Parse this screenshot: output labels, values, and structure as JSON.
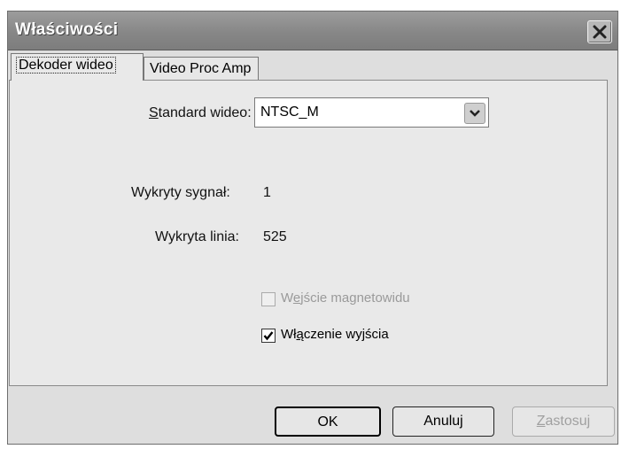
{
  "window": {
    "title": "Właściwości"
  },
  "tabs": [
    {
      "label": "Dekoder wideo",
      "active": true
    },
    {
      "label": "Video Proc Amp",
      "active": false
    }
  ],
  "standard": {
    "label_accel": "S",
    "label_rest": "tandard wideo:",
    "selected": "NTSC_M"
  },
  "signal": {
    "label": "Wykryty sygnał:",
    "value": "1"
  },
  "line": {
    "label": "Wykryta linia:",
    "value": "525"
  },
  "vcr_input": {
    "label_pre": "W",
    "label_accel": "e",
    "label_post": "jście magnetowidu",
    "checked": false,
    "enabled": false
  },
  "output_enable": {
    "label_pre": "Wł",
    "label_accel": "ą",
    "label_post": "czenie wyjścia",
    "checked": true,
    "enabled": true
  },
  "buttons": {
    "ok": "OK",
    "cancel": "Anuluj",
    "apply_accel": "Z",
    "apply_rest": "astosuj"
  }
}
